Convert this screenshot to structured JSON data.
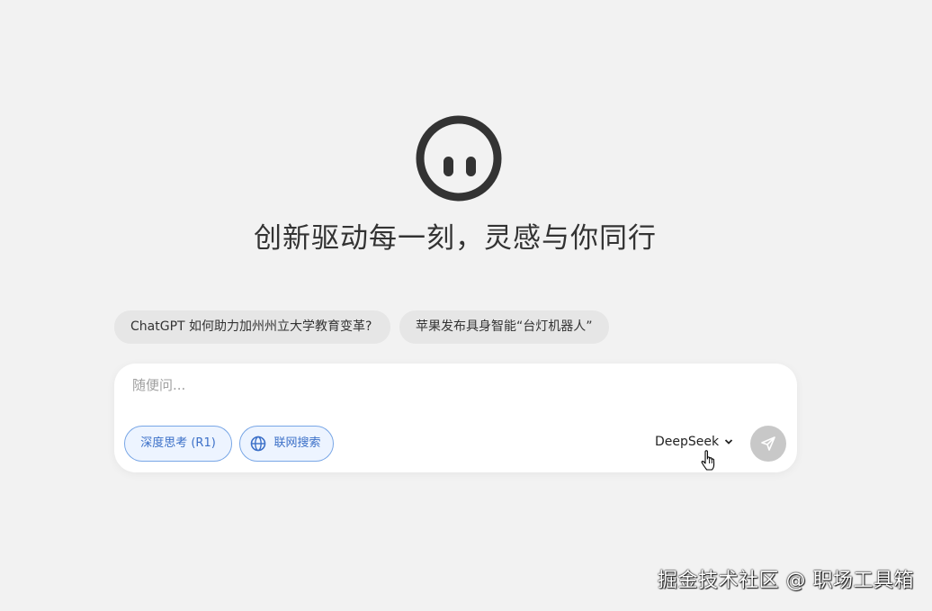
{
  "headline": "创新驱动每一刻，灵感与你同行",
  "suggestions": [
    "ChatGPT 如何助力加州州立大学教育变革?",
    "苹果发布具身智能“台灯机器人”"
  ],
  "composer": {
    "placeholder": "随便问...",
    "value": "",
    "deep_think_label": "深度思考 (R1)",
    "web_search_label": "联网搜索",
    "model_label": "DeepSeek"
  },
  "icons": {
    "logo": "face-logo-icon",
    "globe": "globe-icon",
    "chevron": "chevron-down-icon",
    "send": "send-icon",
    "cursor": "hand-pointer-cursor-icon"
  },
  "colors": {
    "background": "#f2f2f2",
    "accent_blue": "#3c70c8",
    "pill_border": "#78a6e6",
    "send_disabled": "#c8c8c8",
    "text_dark": "#333333"
  },
  "watermark": "掘金技术社区 @ 职场工具箱"
}
